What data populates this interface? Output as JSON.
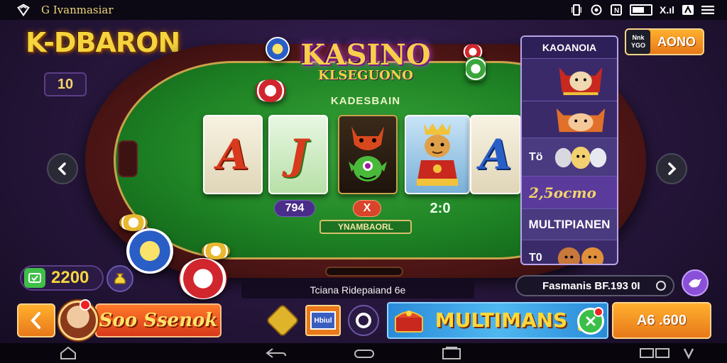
{
  "status_bar": {
    "app_name": "G Ivanmasiar",
    "icons": [
      "logo-icon",
      "vibrate-icon",
      "alarm-icon",
      "nfc-icon",
      "battery-icon",
      "signal-icon",
      "app-icon",
      "menu-icon"
    ],
    "signal_text": "X.ıl"
  },
  "header": {
    "logo": "K-DBARON",
    "level": "10"
  },
  "table": {
    "title": "KASINO",
    "subtitle": "KLSEGUONO",
    "felt_label": "KADESBAIN",
    "reels": [
      {
        "type": "letter",
        "symbol": "A",
        "color": "#d83a1e"
      },
      {
        "type": "letter",
        "symbol": "J",
        "color": "#d83a1e"
      },
      {
        "type": "art",
        "symbol": "fox-goblin"
      },
      {
        "type": "art",
        "symbol": "lion-king"
      },
      {
        "type": "letter",
        "symbol": "A",
        "color": "#2a5ec7"
      }
    ],
    "bet_value": "794",
    "multiplier": "X",
    "score": "2:0",
    "banner": "YNAMBAORL"
  },
  "side_panel": {
    "header": "KAOANOIA",
    "rows": [
      {
        "label": "",
        "art": "devil-cat"
      },
      {
        "label": "",
        "art": "fox-pair"
      },
      {
        "label": "Tö",
        "art": "pup-trio"
      },
      {
        "label": "2,5ocmo",
        "art": ""
      },
      {
        "label": "MULTIPIANEN",
        "art": ""
      },
      {
        "label": "T0",
        "art": "bear-pair"
      }
    ]
  },
  "top_right_button": {
    "tag": "Nnk YGO",
    "label": "AONO"
  },
  "balance": {
    "value": "2200",
    "icon": "coin-icon"
  },
  "info_strip": "Tciana Ridepaiand 6e",
  "status_field": "Fasmanis BF.193 0I",
  "bottom": {
    "spin_label": "Soo Ssenok",
    "promo_title": "MULTIMANS",
    "promo_sub": "",
    "bet_label": "A6 .600",
    "ticket_label": "Hbiul"
  },
  "colors": {
    "accent_orange": "#e8781a",
    "gold": "#f5d43e",
    "felt": "#1f8425",
    "panel": "#3a2a6a"
  }
}
